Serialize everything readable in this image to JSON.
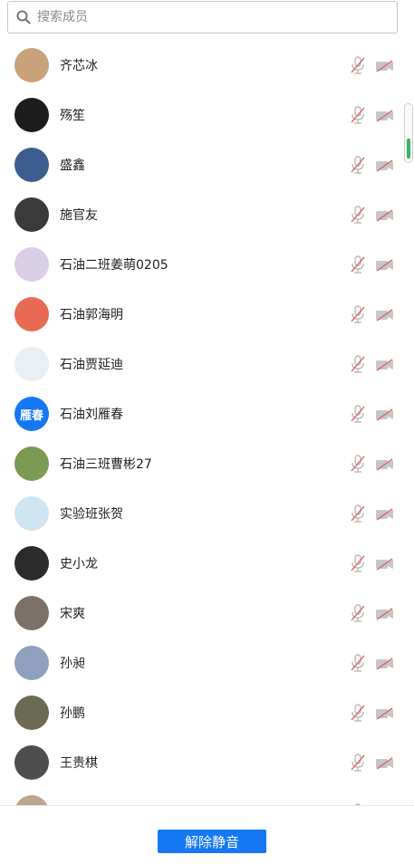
{
  "search": {
    "placeholder": "搜索成员",
    "icon": "search-icon"
  },
  "members": [
    {
      "name": "齐芯冰",
      "avatar_color": "#c9a17a",
      "avatar_text": ""
    },
    {
      "name": "殇笙",
      "avatar_color": "#1c1c1c",
      "avatar_text": ""
    },
    {
      "name": "盛鑫",
      "avatar_color": "#3d5d8f",
      "avatar_text": ""
    },
    {
      "name": "施官友",
      "avatar_color": "#3a3a3a",
      "avatar_text": ""
    },
    {
      "name": "石油二班姜萌0205",
      "avatar_color": "#d9cfe6",
      "avatar_text": ""
    },
    {
      "name": "石油郭海明",
      "avatar_color": "#e86a55",
      "avatar_text": ""
    },
    {
      "name": "石油贾延迪",
      "avatar_color": "#e8f0f6",
      "avatar_text": ""
    },
    {
      "name": "石油刘雁春",
      "avatar_color": "#1677f3",
      "avatar_text": "雁春"
    },
    {
      "name": "石油三班曹彬27",
      "avatar_color": "#7d9a52",
      "avatar_text": ""
    },
    {
      "name": "实验班张贺",
      "avatar_color": "#cfe6f2",
      "avatar_text": ""
    },
    {
      "name": "史小龙",
      "avatar_color": "#2b2b2b",
      "avatar_text": ""
    },
    {
      "name": "宋爽",
      "avatar_color": "#7c7168",
      "avatar_text": ""
    },
    {
      "name": "孙昶",
      "avatar_color": "#8fa1be",
      "avatar_text": ""
    },
    {
      "name": "孙鹏",
      "avatar_color": "#6c6a52",
      "avatar_text": ""
    },
    {
      "name": "王贵棋",
      "avatar_color": "#4e4e4e",
      "avatar_text": ""
    },
    {
      "name": "",
      "avatar_color": "#bba58c",
      "avatar_text": ""
    }
  ],
  "status_icons": {
    "mic": "mic-muted-icon",
    "camera": "camera-off-icon",
    "color": "#e06a6a"
  },
  "footer": {
    "unmute_label": "解除静音",
    "accent": "#1677f3"
  },
  "scrollbar": {
    "accent": "#35b563"
  }
}
